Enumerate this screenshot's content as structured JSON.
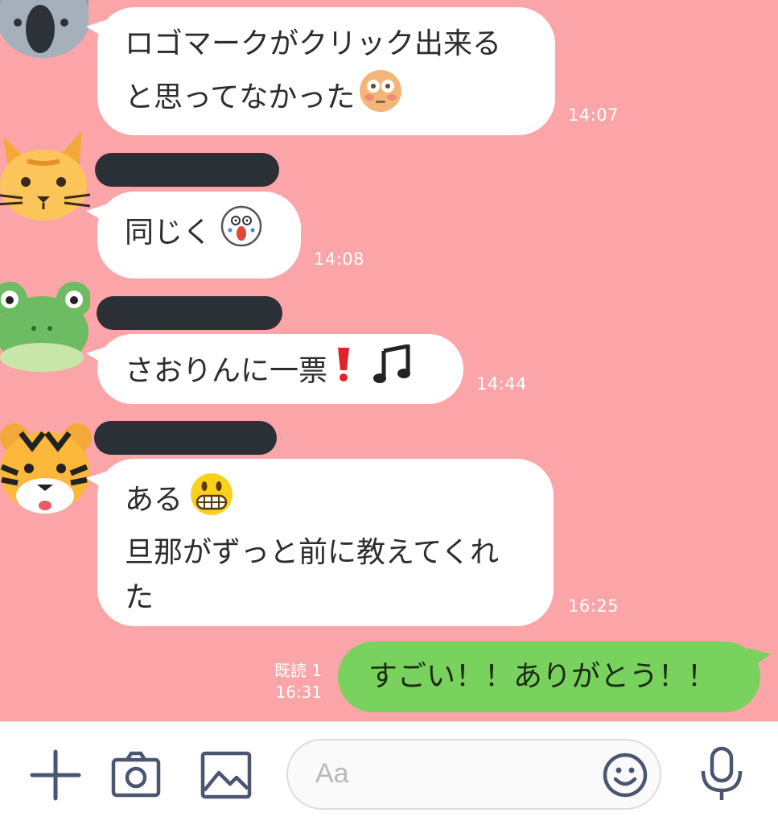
{
  "colors": {
    "background": "#fca5a9",
    "bubble_in": "#ffffff",
    "bubble_out": "#7ad25e",
    "icon": "#4a5670"
  },
  "messages": [
    {
      "avatar": "koala-icon",
      "lines": [
        "ロゴマークがクリック出来る",
        "と思ってなかった"
      ],
      "emoji": "flushed-face-icon",
      "time": "14:07"
    },
    {
      "avatar": "cat-icon",
      "lines": [
        "同じく"
      ],
      "emoji": "screaming-sticker-icon",
      "time": "14:08"
    },
    {
      "avatar": "frog-icon",
      "lines": [
        "さおりんに一票"
      ],
      "emoji": [
        "exclamation-mark-icon",
        "music-notes-icon"
      ],
      "time": "14:44"
    },
    {
      "avatar": "tiger-icon",
      "lines": [
        "ある",
        "旦那がずっと前に教えてくれ",
        "た"
      ],
      "emoji": "grimacing-face-icon",
      "time": "16:25"
    }
  ],
  "outgoing": {
    "text": "すごい！！ありがとう！！",
    "read_label": "既読 1",
    "time": "16:31"
  },
  "input": {
    "placeholder": "Aa"
  }
}
